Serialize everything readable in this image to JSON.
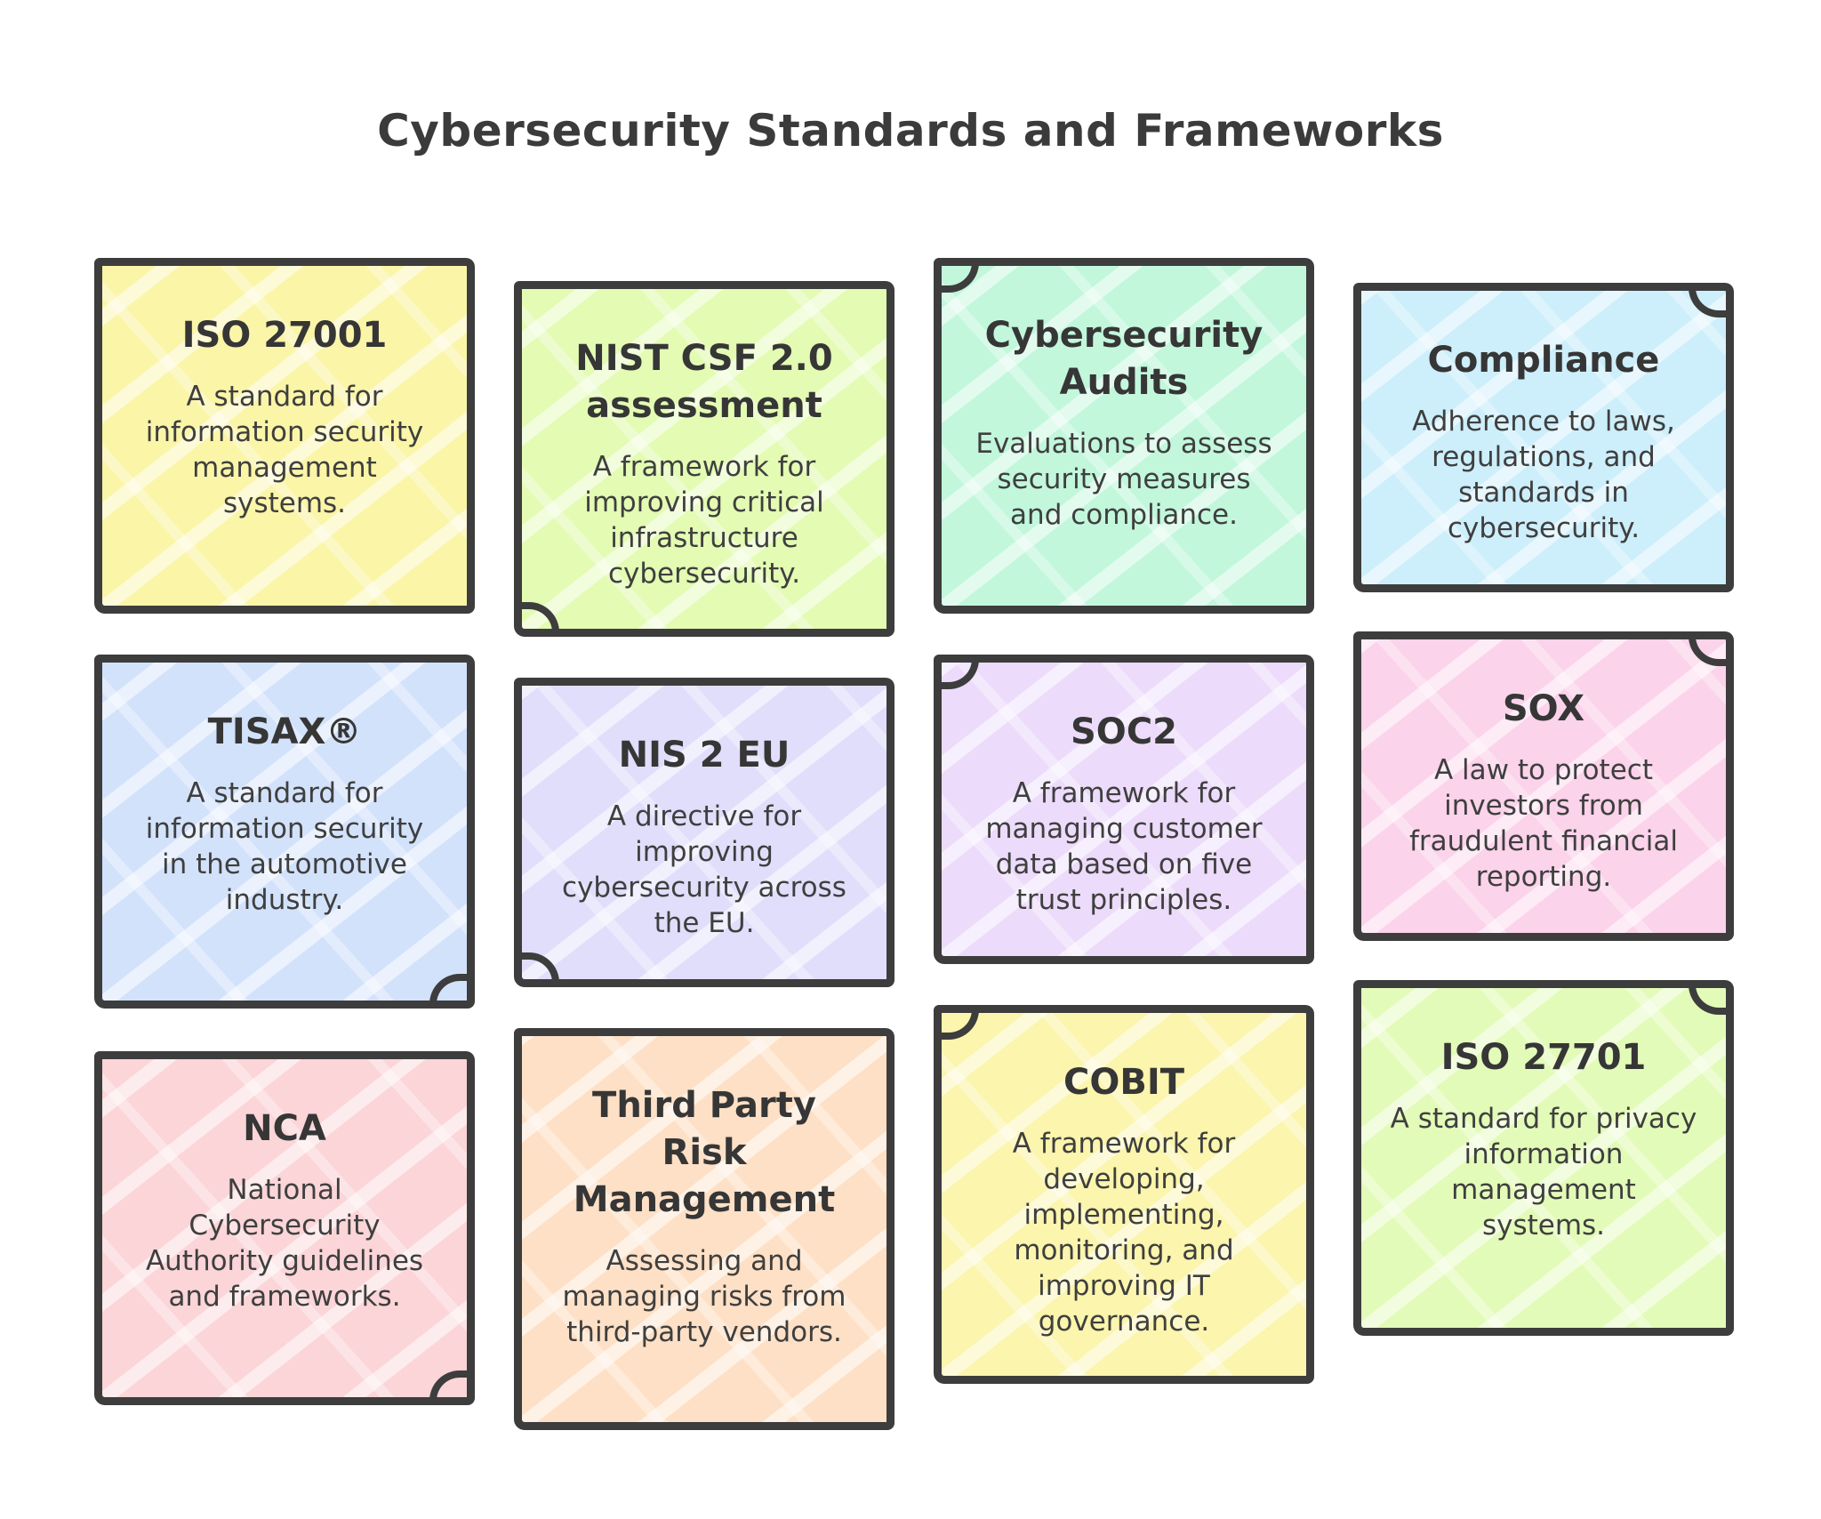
{
  "title": "Cybersecurity Standards and Frameworks",
  "cards": [
    {
      "title": "ISO 27001",
      "description": "A standard for information security management systems.",
      "color": "#fbf5a8"
    },
    {
      "title": "NIST CSF 2.0 assessment",
      "description": "A framework for improving critical infrastructure cybersecurity.",
      "color": "#e3fbb3"
    },
    {
      "title": "Cybersecurity Audits",
      "description": "Evaluations to assess security measures and compliance.",
      "color": "#c2f7dc"
    },
    {
      "title": "Compliance",
      "description": "Adherence to laws, regulations, and standards in cybersecurity.",
      "color": "#cdeefb"
    },
    {
      "title": "TISAX®",
      "description": "A standard for information security in the automotive industry.",
      "color": "#d3e2fb"
    },
    {
      "title": "NIS 2 EU",
      "description": "A directive for improving cybersecurity across the EU.",
      "color": "#e1defb"
    },
    {
      "title": "SOC2",
      "description": "A framework for managing customer data based on five trust principles.",
      "color": "#ecdbfa"
    },
    {
      "title": "SOX",
      "description": "A law to protect investors from fraudulent financial reporting.",
      "color": "#fbd3ea"
    },
    {
      "title": "NCA",
      "description": "National Cybersecurity Authority guidelines and frameworks.",
      "color": "#fbd5d8"
    },
    {
      "title": "Third Party Risk Management",
      "description": "Assessing and managing risks from third-party vendors.",
      "color": "#fde0c6"
    },
    {
      "title": "COBIT",
      "description": "A framework for developing, implementing, monitoring, and improving IT governance.",
      "color": "#fbf5ad"
    },
    {
      "title": "ISO 27701",
      "description": "A standard for privacy information management systems.",
      "color": "#e3fbb8"
    }
  ]
}
